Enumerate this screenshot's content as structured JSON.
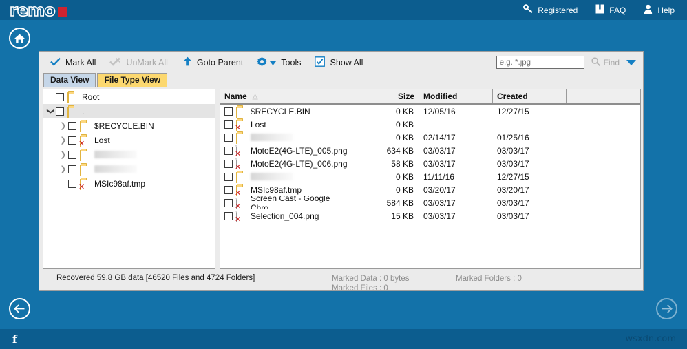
{
  "header": {
    "logo_text": "remo",
    "links": [
      {
        "icon": "key-icon",
        "label": "Registered"
      },
      {
        "icon": "book-icon",
        "label": "FAQ"
      },
      {
        "icon": "person-icon",
        "label": "Help"
      }
    ]
  },
  "toolbar": {
    "mark_all": "Mark All",
    "unmark_all": "UnMark All",
    "goto_parent": "Goto Parent",
    "tools": "Tools",
    "show_all": "Show All",
    "search_placeholder": "e.g. *.jpg",
    "search_value": "",
    "find_label": "Find"
  },
  "tabs": [
    {
      "label": "Data View",
      "active": true
    },
    {
      "label": "File Type View",
      "active": false
    }
  ],
  "tree": {
    "nodes": [
      {
        "label": "Root",
        "icon": "folder-icon",
        "level": 0,
        "chevron": "",
        "selected": false,
        "blurred": false
      },
      {
        "label": ".",
        "icon": "folder-icon",
        "level": 1,
        "chevron": "down",
        "selected": true,
        "blurred": false
      },
      {
        "label": "$RECYCLE.BIN",
        "icon": "folder-icon",
        "level": 2,
        "chevron": "right",
        "selected": false,
        "blurred": false
      },
      {
        "label": "Lost",
        "icon": "folder-deleted-icon",
        "level": 2,
        "chevron": "right",
        "selected": false,
        "blurred": false
      },
      {
        "label": "",
        "icon": "folder-icon",
        "level": 2,
        "chevron": "right",
        "selected": false,
        "blurred": true
      },
      {
        "label": "",
        "icon": "folder-icon",
        "level": 2,
        "chevron": "right",
        "selected": false,
        "blurred": true
      },
      {
        "label": "MSIc98af.tmp",
        "icon": "folder-deleted-icon",
        "level": 2,
        "chevron": "",
        "selected": false,
        "blurred": false
      }
    ]
  },
  "filelist": {
    "columns": [
      "Name",
      "Size",
      "Modified",
      "Created",
      ""
    ],
    "sort_column": "Name",
    "sort_indicator": "△",
    "rows": [
      {
        "name": "$RECYCLE.BIN",
        "icon": "folder-icon",
        "size": "0 KB",
        "modified": "12/05/16",
        "created": "12/27/15",
        "blurred": false
      },
      {
        "name": "Lost",
        "icon": "folder-deleted-icon",
        "size": "0 KB",
        "modified": "",
        "created": "",
        "blurred": false
      },
      {
        "name": "",
        "icon": "folder-icon",
        "size": "0 KB",
        "modified": "02/14/17",
        "created": "01/25/16",
        "blurred": true
      },
      {
        "name": "MotoE2(4G-LTE)_005.png",
        "icon": "file-deleted-icon",
        "size": "634 KB",
        "modified": "03/03/17",
        "created": "03/03/17",
        "blurred": false
      },
      {
        "name": "MotoE2(4G-LTE)_006.png",
        "icon": "file-deleted-icon",
        "size": "58 KB",
        "modified": "03/03/17",
        "created": "03/03/17",
        "blurred": false
      },
      {
        "name": "",
        "icon": "folder-icon",
        "size": "0 KB",
        "modified": "11/11/16",
        "created": "12/27/15",
        "blurred": true
      },
      {
        "name": "MSIc98af.tmp",
        "icon": "folder-deleted-icon",
        "size": "0 KB",
        "modified": "03/20/17",
        "created": "03/20/17",
        "blurred": false
      },
      {
        "name": "Screen Cast - Google Chro...",
        "icon": "file-deleted-icon",
        "size": "584 KB",
        "modified": "03/03/17",
        "created": "03/03/17",
        "blurred": false
      },
      {
        "name": "Selection_004.png",
        "icon": "file-deleted-icon",
        "size": "15 KB",
        "modified": "03/03/17",
        "created": "03/03/17",
        "blurred": false
      }
    ]
  },
  "status": {
    "recovered": "Recovered 59.8 GB data [46520 Files and 4724 Folders]",
    "marked_data": "Marked Data : 0 bytes",
    "marked_files": "Marked Files : 0",
    "marked_folders": "Marked Folders : 0"
  },
  "footer": {
    "facebook": "f",
    "watermark": "wsxdn.com"
  },
  "colors": {
    "header_blue": "#0c5d8f",
    "canvas_blue": "#1372a9",
    "accent_blue": "#1580c4",
    "logo_red": "#cf2430",
    "tab_yellow": "#fcd86f",
    "tab_active": "#c5d6e8"
  }
}
